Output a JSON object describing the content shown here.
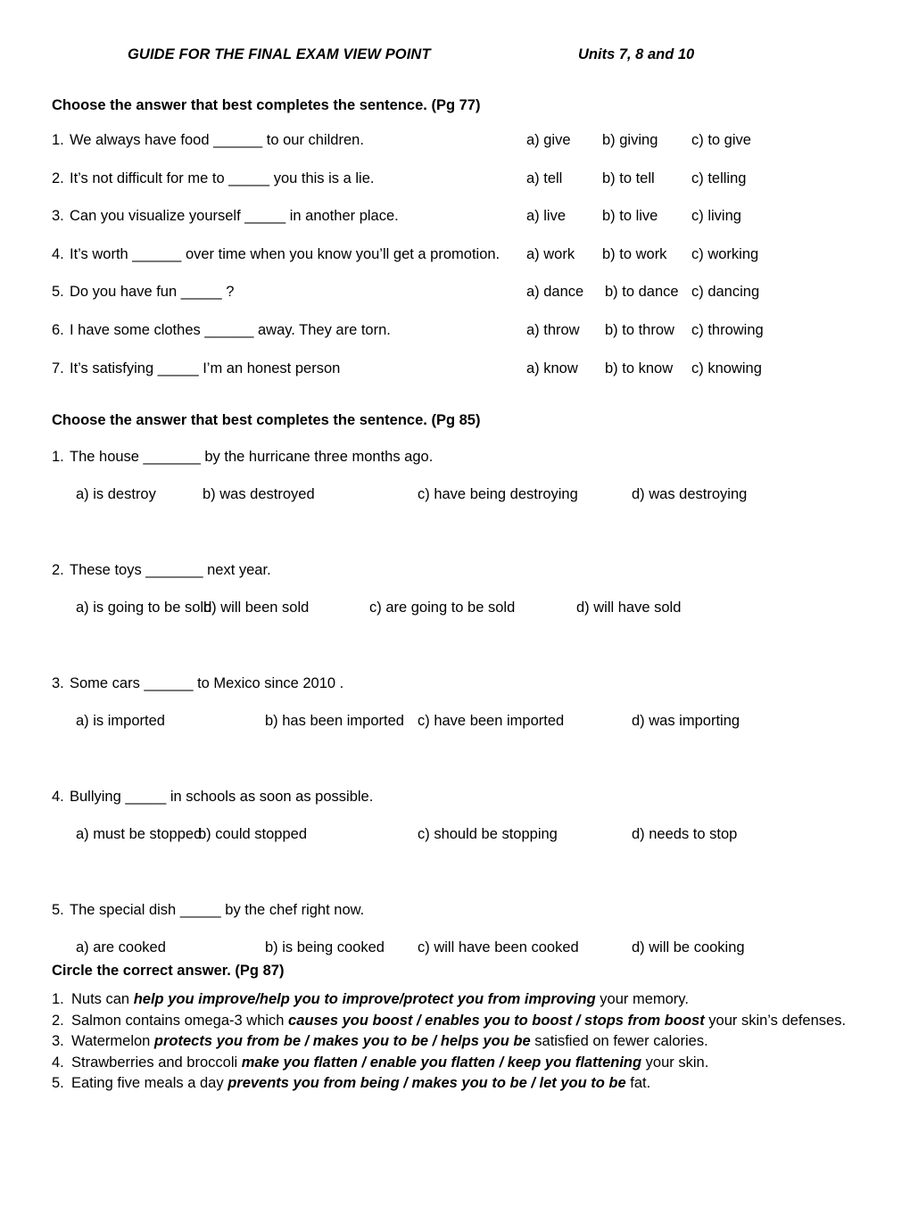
{
  "header": {
    "title": "GUIDE FOR THE FINAL EXAM VIEW POINT",
    "units": "Units 7, 8 and 10"
  },
  "section1": {
    "heading": "Choose the answer that best completes the sentence. (Pg 77)",
    "questions": [
      {
        "num": "1.",
        "text": "We always have food ______ to our children.",
        "a": "a) give",
        "b": "b) giving",
        "c": "c) to give"
      },
      {
        "num": "2.",
        "text": "It’s not difficult for me to _____ you this is a lie.",
        "a": "a) tell",
        "b": "b) to tell",
        "c": "c) telling"
      },
      {
        "num": "3.",
        "text": "Can you visualize yourself _____ in another place.",
        "a": "a) live",
        "b": "b) to live",
        "c": "c) living"
      },
      {
        "num": "4.",
        "text": "It’s worth ______ over time when you know you’ll get a promotion.",
        "a": "a) work",
        "b": "b) to work",
        "c": "c) working"
      },
      {
        "num": "5.",
        "text": "Do you have fun _____ ?",
        "a": "a) dance",
        "b": "b) to dance",
        "c": "c) dancing"
      },
      {
        "num": "6.",
        "text": "I have some clothes ______ away. They are torn.",
        "a": "a) throw",
        "b": "b) to throw",
        "c": "c) throwing"
      },
      {
        "num": "7.",
        "text": "It’s satisfying _____ I’m an honest person",
        "a": "a) know",
        "b": "b) to know",
        "c": "c) knowing"
      }
    ]
  },
  "section2": {
    "heading": "Choose the answer that best completes the sentence. (Pg 85)",
    "questions": [
      {
        "num": "1.",
        "text": "The house _______ by the hurricane three months ago.",
        "a": "a) is destroy",
        "b": "b) was destroyed",
        "c": "c) have being destroying",
        "d": "d) was destroying"
      },
      {
        "num": "2.",
        "text": "These toys _______ next year.",
        "a": "a) is going to be sold",
        "b": "b) will been sold",
        "c": "c) are going to be sold",
        "d": "d) will have sold"
      },
      {
        "num": "3.",
        "text": "Some cars ______ to Mexico since 2010 .",
        "a": "a) is imported",
        "b": "b) has been imported",
        "c": "c) have been imported",
        "d": "d) was importing"
      },
      {
        "num": "4.",
        "text": "Bullying _____ in schools as soon as possible.",
        "a": "a) must be stopped",
        "b": "b) could stopped",
        "c": "c) should be stopping",
        "d": "d) needs to stop"
      },
      {
        "num": "5.",
        "text": "The special dish _____ by the chef right now.",
        "a": "a) are cooked",
        "b": "b) is being cooked",
        "c": "c) will have been cooked",
        "d": "d) will be cooking"
      }
    ]
  },
  "section3": {
    "heading": "Circle the correct answer. (Pg 87)",
    "items": [
      {
        "num": "1.",
        "before": "Nuts can ",
        "bold": "help you improve/help you to improve/protect you from improving",
        "after": " your memory."
      },
      {
        "num": "2.",
        "before": "Salmon contains omega-3 which ",
        "bold": "causes you boost / enables you to boost / stops from boost",
        "after": " your skin’s defenses."
      },
      {
        "num": "3.",
        "before": "Watermelon ",
        "bold": "protects you from be / makes you to be / helps you be",
        "after": " satisfied on fewer calories."
      },
      {
        "num": "4.",
        "before": "Strawberries and broccoli ",
        "bold": "make you flatten / enable you flatten / keep you flattening",
        "after": " your skin."
      },
      {
        "num": "5.",
        "before": "Eating five meals a day ",
        "bold": "prevents you from being / makes you to be / let you to be",
        "after": " fat."
      }
    ]
  }
}
